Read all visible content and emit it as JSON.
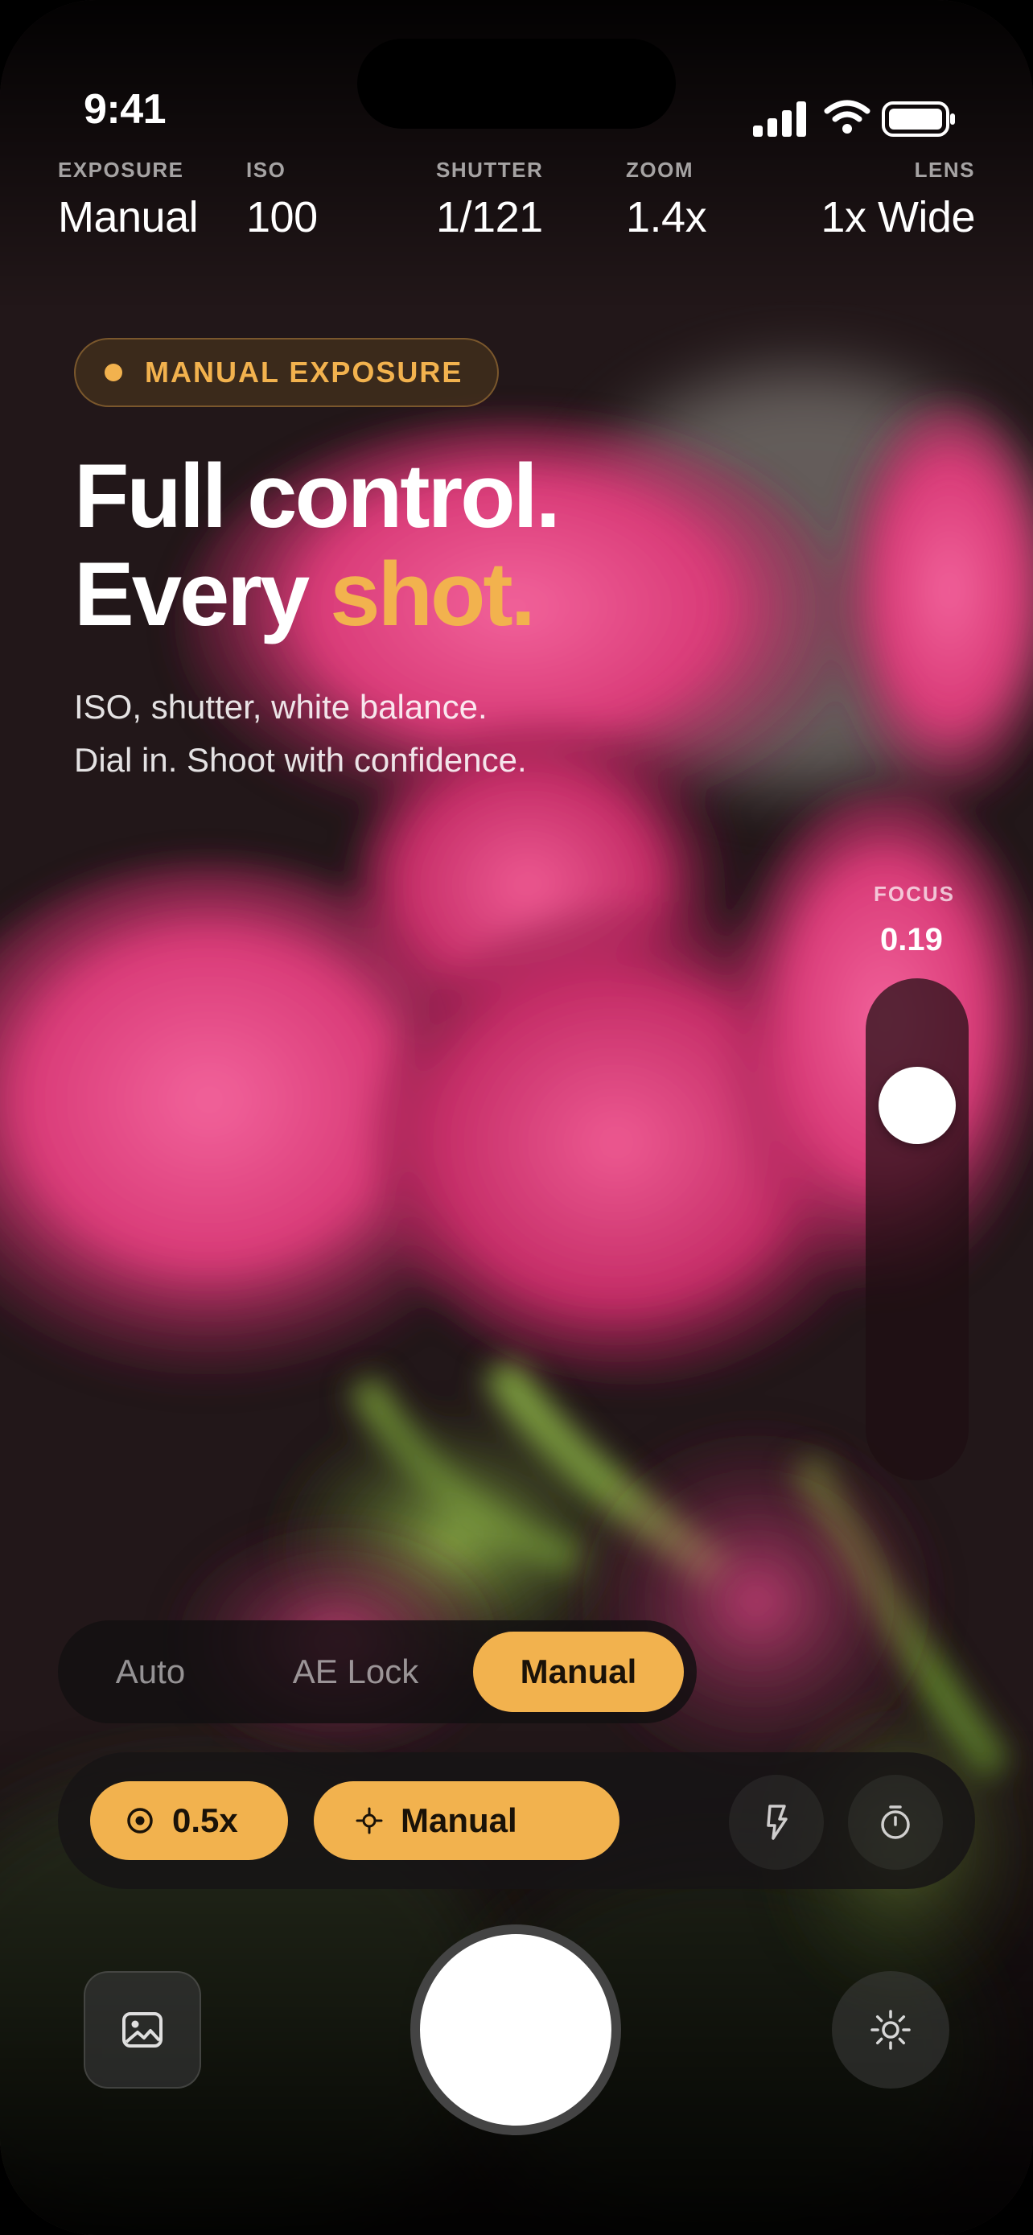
{
  "status": {
    "time": "9:41"
  },
  "readouts": [
    {
      "label": "EXPOSURE",
      "value": "Manual"
    },
    {
      "label": "ISO",
      "value": "100"
    },
    {
      "label": "SHUTTER",
      "value": "1/121"
    },
    {
      "label": "ZOOM",
      "value": "1.4x"
    },
    {
      "label": "LENS",
      "value": "1x Wide"
    }
  ],
  "badge": {
    "label": "MANUAL EXPOSURE"
  },
  "headline": {
    "line1": "Full control.",
    "line2_prefix": "Every ",
    "line2_accent": "shot."
  },
  "subtitle": {
    "line1": "ISO, shutter, white balance.",
    "line2": "Dial in. Shoot with confidence."
  },
  "focus": {
    "label": "FOCUS",
    "value_text": "0.19",
    "value": 0.19
  },
  "modes": {
    "items": [
      "Auto",
      "AE Lock",
      "Manual"
    ],
    "selected": "Manual"
  },
  "toolbar": {
    "lens_chip": "0.5x",
    "focus_chip": "Manual"
  },
  "icons": {
    "flash": "flash-icon",
    "timer": "timer-icon",
    "gallery": "gallery-icon",
    "brightness": "brightness-icon",
    "lens": "target-icon",
    "focus": "crosshair-icon"
  },
  "colors": {
    "accent": "#f2b24e",
    "subject": "#e0407a"
  }
}
